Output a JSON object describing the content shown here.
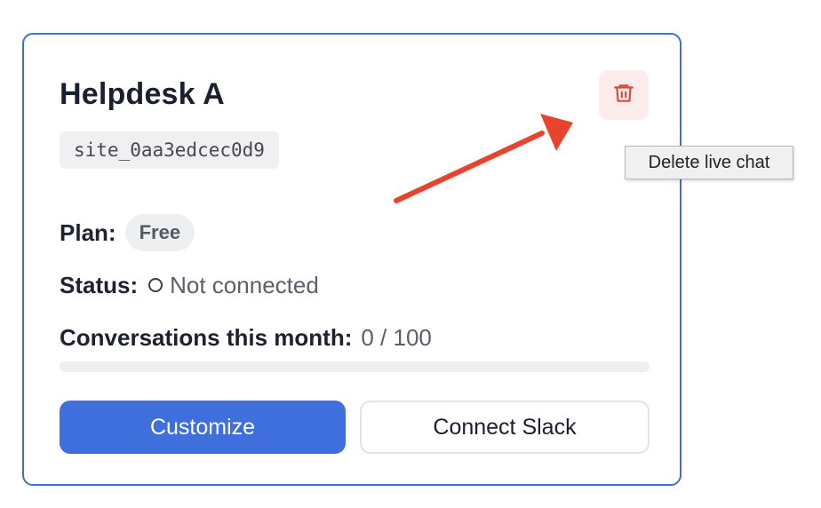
{
  "card": {
    "title": "Helpdesk A",
    "site_id": "site_0aa3edcec0d9",
    "delete_icon": "trash-icon",
    "plan_label": "Plan:",
    "plan_value": "Free",
    "status_label": "Status:",
    "status_value": "Not connected",
    "status_icon": "circle-outline-icon",
    "conversations_label": "Conversations this month:",
    "conversations_value": "0 / 100",
    "conversations_progress": 0,
    "customize_label": "Customize",
    "connect_slack_label": "Connect Slack"
  },
  "tooltip": {
    "text": "Delete live chat"
  },
  "colors": {
    "accent": "#3e6fdc",
    "danger": "#d9483b",
    "danger_bg": "#fdecec",
    "annotation_arrow": "#e8432e"
  }
}
